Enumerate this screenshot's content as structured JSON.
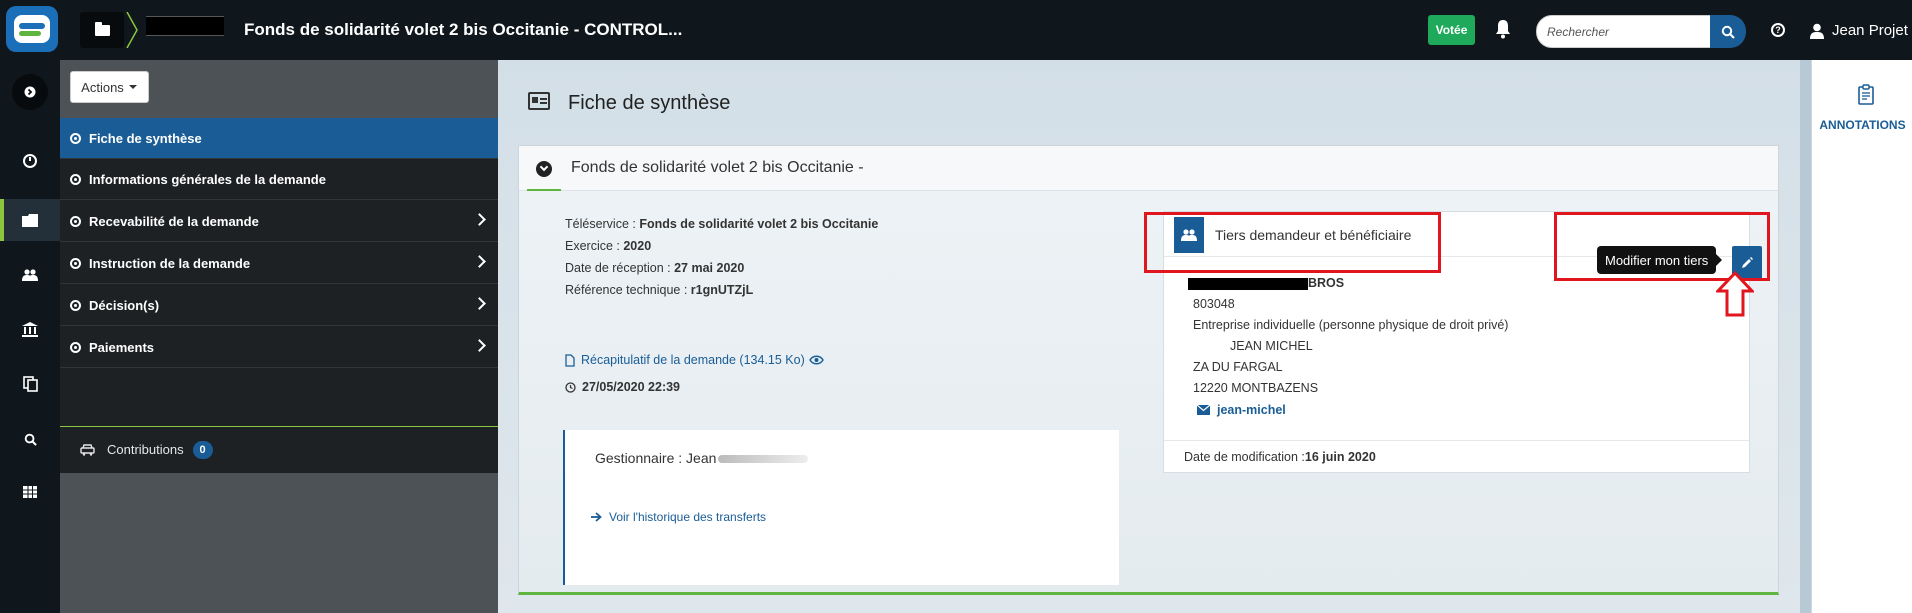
{
  "topbar": {
    "title": "Fonds de solidarité volet 2 bis Occitanie - CONTROL...",
    "status_badge": "Votée",
    "search_placeholder": "Rechercher",
    "user_name": "Jean Projet"
  },
  "sidebar": {
    "actions_label": "Actions",
    "items": [
      {
        "label": "Fiche de synthèse",
        "active": true
      },
      {
        "label": "Informations générales de la demande"
      },
      {
        "label": "Recevabilité de la demande"
      },
      {
        "label": "Instruction de la demande"
      },
      {
        "label": "Décision(s)"
      },
      {
        "label": "Paiements"
      }
    ],
    "contributions": {
      "label": "Contributions",
      "count": "0"
    }
  },
  "main": {
    "header": "Fiche de synthèse",
    "panel_title": "Fonds de solidarité volet 2 bis Occitanie -",
    "info": {
      "teleservice_label": "Téléservice : ",
      "teleservice_value": "Fonds de solidarité volet 2 bis Occitanie",
      "exercice_label": "Exercice : ",
      "exercice_value": "2020",
      "reception_label": "Date de réception : ",
      "reception_value": "27 mai 2020",
      "ref_label": "Référence technique : ",
      "ref_value": "r1gnUTZjL"
    },
    "recap_link": "Récapitulatif de la demande (134.15 Ko)",
    "recap_date": "27/05/2020 22:39",
    "gestionnaire_label": "Gestionnaire : Jean",
    "history_link": "Voir l'historique des transferts",
    "tiers": {
      "title": "Tiers demandeur et bénéficiaire",
      "tooltip": "Modifier mon tiers",
      "name_suffix": "BROS",
      "siret": "803048",
      "legal_form": "Entreprise individuelle (personne physique de droit privé)",
      "contact": "JEAN MICHEL",
      "address1": "ZA DU FARGAL",
      "address2": "12220 MONTBAZENS",
      "email": "jean-michel",
      "modified_label": "Date de modification : ",
      "modified_value": "16 juin 2020"
    }
  },
  "annotations": {
    "label": "ANNOTATIONS"
  },
  "colors": {
    "topbar_bg": "#0f171c",
    "accent_blue": "#1a5d96",
    "accent_green": "#5fb53f",
    "badge_green": "#1eaa5a",
    "highlight_red": "#e0151d"
  }
}
